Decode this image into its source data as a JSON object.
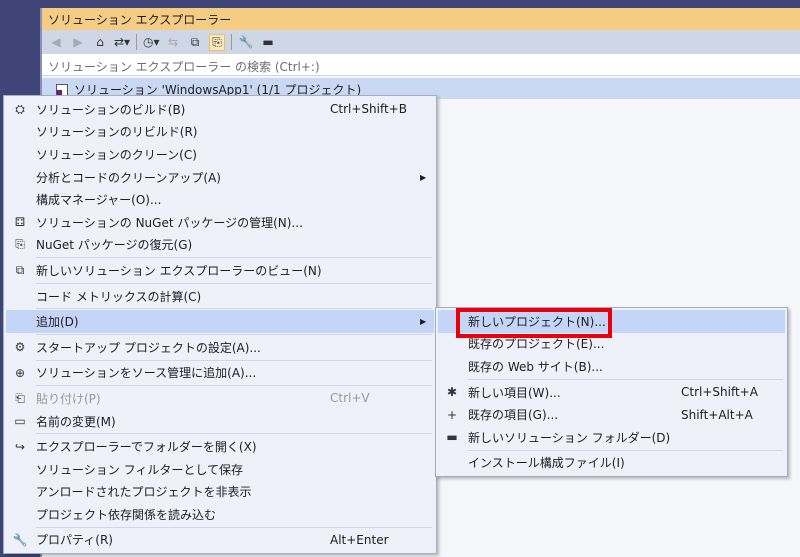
{
  "panel": {
    "title": "ソリューション エクスプローラー",
    "search_placeholder": "ソリューション エクスプローラー の検索 (Ctrl+:)",
    "tree_item": "ソリューション 'WindowsApp1' (1/1 プロジェクト)"
  },
  "toolbar": {
    "icons": [
      "back-icon",
      "forward-icon",
      "home-icon",
      "switch-views-icon",
      "pending-changes-icon",
      "sync-icon",
      "collapse-all-icon",
      "show-all-files-icon",
      "properties-icon",
      "preview-icon"
    ]
  },
  "menu": {
    "items": [
      {
        "label": "ソリューションのビルド(B)",
        "shortcut": "Ctrl+Shift+B",
        "icon": "⛭"
      },
      {
        "label": "ソリューションのリビルド(R)"
      },
      {
        "label": "ソリューションのクリーン(C)"
      },
      {
        "label": "分析とコードのクリーンアップ(A)",
        "submenu": true
      },
      {
        "label": "構成マネージャー(O)..."
      },
      {
        "label": "ソリューションの NuGet パッケージの管理(N)...",
        "icon": "⚃"
      },
      {
        "label": "NuGet パッケージの復元(G)",
        "icon": "⎘"
      },
      {
        "label": "新しいソリューション エクスプローラーのビュー(N)",
        "icon": "⧉"
      },
      {
        "label": "コード メトリックスの計算(C)"
      },
      {
        "label": "追加(D)",
        "submenu": true
      },
      {
        "label": "スタートアップ プロジェクトの設定(A)...",
        "icon": "⚙"
      },
      {
        "label": "ソリューションをソース管理に追加(A)...",
        "icon": "⊕"
      },
      {
        "label": "貼り付け(P)",
        "shortcut": "Ctrl+V",
        "icon": "⎗"
      },
      {
        "label": "名前の変更(M)",
        "icon": "▭"
      },
      {
        "label": "エクスプローラーでフォルダーを開く(X)",
        "icon": "↪"
      },
      {
        "label": "ソリューション フィルターとして保存"
      },
      {
        "label": "アンロードされたプロジェクトを非表示"
      },
      {
        "label": "プロジェクト依存関係を読み込む"
      },
      {
        "label": "プロパティ(R)",
        "shortcut": "Alt+Enter",
        "icon": "🔧"
      }
    ]
  },
  "submenu": {
    "items": [
      {
        "label": "新しいプロジェクト(N)..."
      },
      {
        "label": "既存のプロジェクト(E)..."
      },
      {
        "label": "既存の Web サイト(B)..."
      },
      {
        "label": "新しい項目(W)...",
        "shortcut": "Ctrl+Shift+A",
        "icon": "✱"
      },
      {
        "label": "既存の項目(G)...",
        "shortcut": "Shift+Alt+A",
        "icon": "+"
      },
      {
        "label": "新しいソリューション フォルダー(D)",
        "icon": "▬"
      },
      {
        "label": "インストール構成ファイル(I)"
      }
    ]
  }
}
